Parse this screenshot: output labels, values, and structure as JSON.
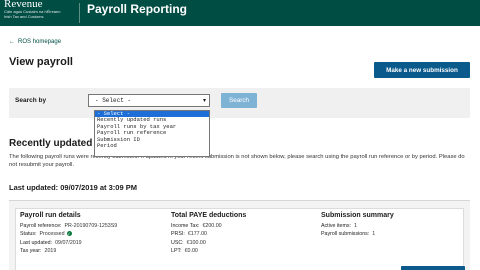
{
  "header": {
    "logo_main": "Revenue",
    "logo_sub_1": "Cáin agus Custaim na hÉireann",
    "logo_sub_2": "Irish Tax and Customs",
    "title": "Payroll Reporting"
  },
  "nav": {
    "back_link": "ROS homepage"
  },
  "page": {
    "title": "View payroll",
    "new_submission_button": "Make a new submission"
  },
  "search": {
    "label": "Search by",
    "selected": "- Select -",
    "button": "Search",
    "options": [
      "- Select -",
      "Recently updated runs",
      "Payroll runs by tax year",
      "Payroll run reference",
      "Submission ID",
      "Period"
    ]
  },
  "recent": {
    "title": "Recently updated",
    "info": "The following payroll runs were recently submitted. If updated in your recent submission is not shown below, please search using the payroll run reference or by period. Please do not resubmit your payroll.",
    "last_updated": "Last updated: 09/07/2019 at 3:09 PM"
  },
  "card": {
    "details": {
      "heading": "Payroll run details",
      "rows": [
        {
          "label": "Payroll reference:",
          "value": "PR-20190709-1253S9"
        },
        {
          "label": "Status:",
          "value": "Processed"
        },
        {
          "label": "Last updated:",
          "value": "09/07/2019"
        },
        {
          "label": "Tax year:",
          "value": "2019"
        }
      ]
    },
    "deductions": {
      "heading": "Total PAYE deductions",
      "rows": [
        {
          "label": "Income Tax:",
          "value": "€200.00"
        },
        {
          "label": "PRSI:",
          "value": "€177.00"
        },
        {
          "label": "USC:",
          "value": "€100.00"
        },
        {
          "label": "LPT:",
          "value": "€0.00"
        }
      ]
    },
    "summary": {
      "heading": "Submission summary",
      "rows": [
        {
          "label": "Active items:",
          "value": "1"
        },
        {
          "label": "Payroll submissions:",
          "value": "1"
        }
      ]
    }
  },
  "colors": {
    "header_bg": "#004d44",
    "primary_button": "#0b5a8c",
    "search_button": "#7fb3d5",
    "dropdown_highlight": "#1e6ed8",
    "status_ok": "#0a7a3e"
  }
}
